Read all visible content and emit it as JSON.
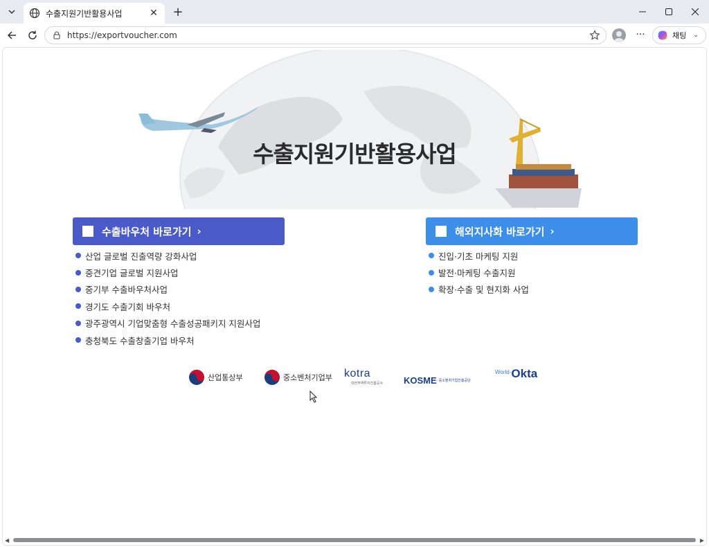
{
  "browser": {
    "tab_title": "수출지원기반활용사업",
    "url": "https://exportvoucher.com",
    "copilot_label": "채팅",
    "icons": [
      "tab-list-icon",
      "globe-icon",
      "close-icon",
      "plus-icon",
      "minimize-icon",
      "maximize-icon",
      "window-close-icon",
      "back-icon",
      "reload-icon",
      "lock-icon",
      "star-icon",
      "profile-icon",
      "more-icon",
      "copilot-icon"
    ]
  },
  "hero": {
    "title": "수출지원기반활용사업"
  },
  "export_voucher": {
    "button_label": "수출바우처 바로가기",
    "arrow": "›",
    "color": "#4a5ac8",
    "items": [
      "산업 글로벌 진출역량 강화사업",
      "중견기업 글로벌 지원사업",
      "중기부 수출바우처사업",
      "경기도 수출기회 바우처",
      "광주광역시 기업맞춤형 수출성공패키지 지원사업",
      "충청북도 수출창출기업 바우처"
    ]
  },
  "overseas_branch": {
    "button_label": "해외지사화 바로가기",
    "arrow": "›",
    "color": "#3c8ee8",
    "items": [
      "진입·기초 마케팅 지원",
      "발전·마케팅 수출지원",
      "확장·수출 및 현지화 사업"
    ]
  },
  "logos": {
    "motie": "산업통상부",
    "mss": "중소벤처기업부",
    "kotra": "kotra",
    "kotra_sub": "대한무역투자진흥공사",
    "kosme": "KOSME",
    "kosme_sub": "중소벤처기업진흥공단",
    "okta_prefix": "World-",
    "okta": "Okta"
  }
}
